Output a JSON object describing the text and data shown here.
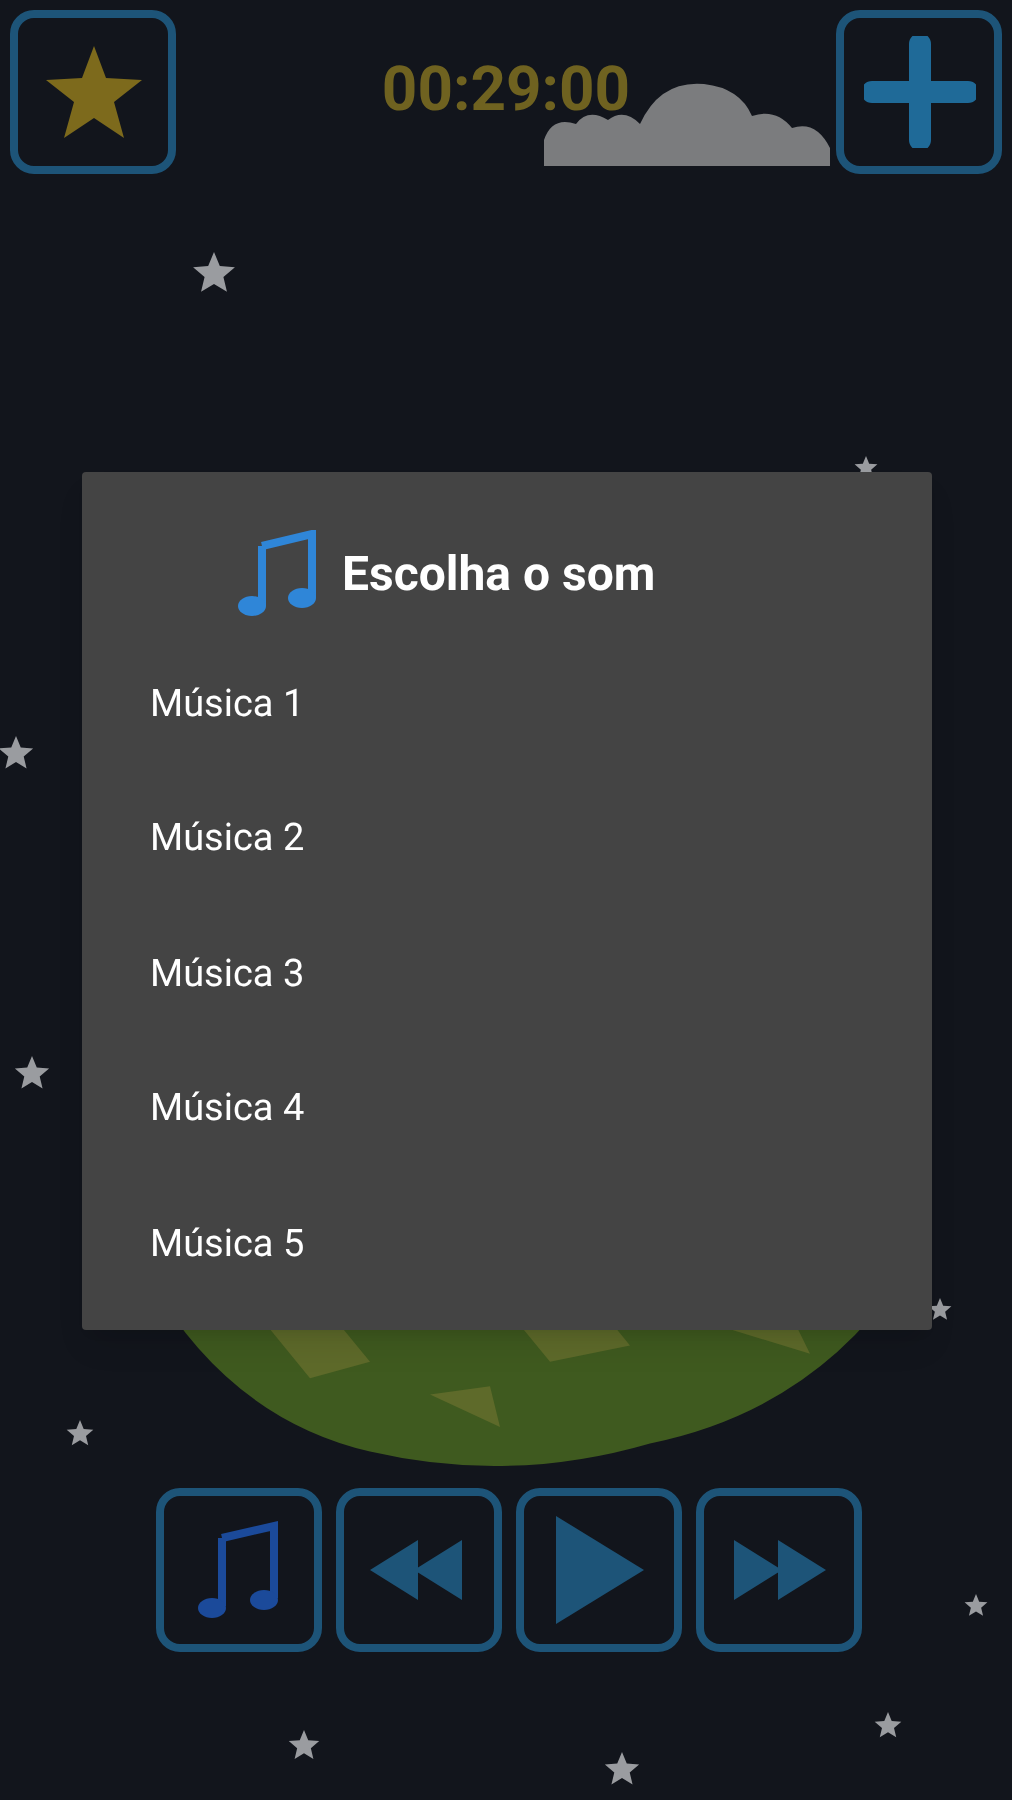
{
  "timer": "00:29:00",
  "dialog": {
    "title": "Escolha o som",
    "items": [
      "Música 1",
      "Música 2",
      "Música 3",
      "Música 4",
      "Música 5"
    ]
  }
}
